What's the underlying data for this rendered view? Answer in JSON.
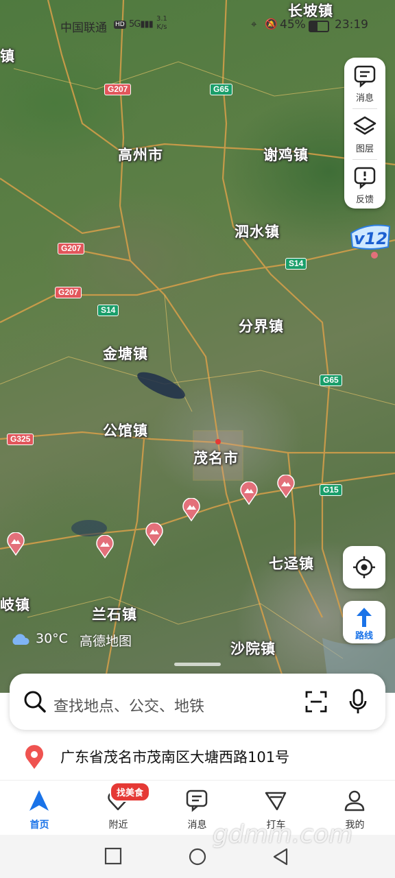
{
  "status_bar": {
    "carrier": "中国联通",
    "hd": "HD",
    "signal": "5G",
    "net_speed": "3.1",
    "net_unit": "K/s",
    "battery": "45%",
    "time": "23:19"
  },
  "map": {
    "places": [
      {
        "name": "长坡镇"
      },
      {
        "name": "镇"
      },
      {
        "name": "高州市"
      },
      {
        "name": "谢鸡镇"
      },
      {
        "name": "泗水镇"
      },
      {
        "name": "分界镇"
      },
      {
        "name": "金塘镇"
      },
      {
        "name": "公馆镇"
      },
      {
        "name": "茂名市"
      },
      {
        "name": "七迳镇"
      },
      {
        "name": "岐镇"
      },
      {
        "name": "兰石镇"
      },
      {
        "name": "沙院镇"
      }
    ],
    "highways": [
      {
        "code": "G207",
        "kind": "national"
      },
      {
        "code": "G65",
        "kind": "expressway"
      },
      {
        "code": "G207",
        "kind": "national"
      },
      {
        "code": "G207",
        "kind": "national"
      },
      {
        "code": "S14",
        "kind": "expressway"
      },
      {
        "code": "S14",
        "kind": "expressway"
      },
      {
        "code": "G65",
        "kind": "expressway"
      },
      {
        "code": "G325",
        "kind": "national"
      },
      {
        "code": "G15",
        "kind": "expressway"
      }
    ],
    "weather_temp": "30°C",
    "map_brand": "高德地图",
    "badge_icon": "v12"
  },
  "side_panel": {
    "messages_label": "消息",
    "layers_label": "图层",
    "feedback_label": "反馈"
  },
  "route_button_label": "路线",
  "search": {
    "placeholder": "查找地点、公交、地铁"
  },
  "current_address": "广东省茂名市茂南区大塘西路101号",
  "tabs": [
    {
      "label": "首页",
      "icon": "navigate-arrow-icon",
      "active": true
    },
    {
      "label": "附近",
      "icon": "heart-location-icon",
      "active": false
    },
    {
      "label": "消息",
      "icon": "message-icon",
      "active": false
    },
    {
      "label": "打车",
      "icon": "taxi-flag-icon",
      "active": false
    },
    {
      "label": "我的",
      "icon": "person-icon",
      "active": false
    }
  ],
  "nearby_badge": "找美食",
  "watermark": "gdmm.com",
  "colors": {
    "accent": "#1a73e8",
    "national_highway": "#e2565b",
    "expressway": "#1a9e6a",
    "badge": "#e53935"
  }
}
